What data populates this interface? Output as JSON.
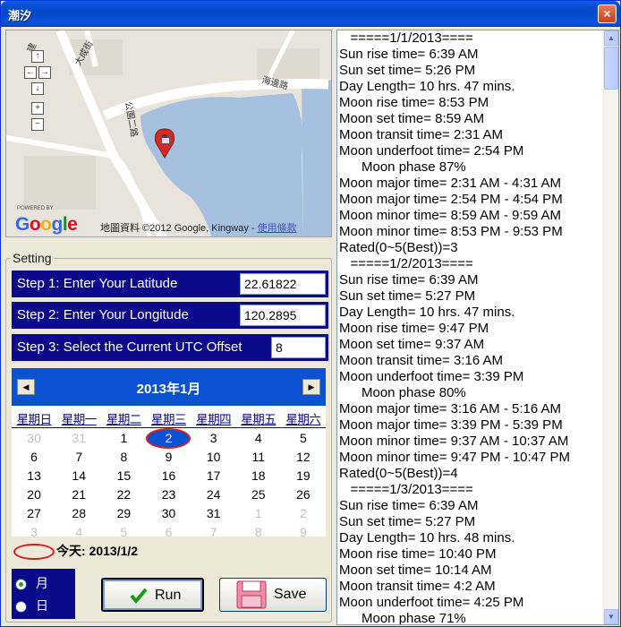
{
  "window": {
    "title": "潮汐",
    "close_label": "×"
  },
  "map": {
    "attribution": "地圖資料 ©2012 Google, Kingway -",
    "terms_link": "使用條款",
    "powered_by": "POWERED BY",
    "logo": "Google",
    "street_labels": [
      "大成街",
      "公園二路",
      "海邊路",
      "建"
    ],
    "nav": {
      "up": "↑",
      "left": "←",
      "right": "→",
      "down": "↓",
      "zoom_in": "+",
      "zoom_out": "−"
    }
  },
  "settings": {
    "legend": "Setting",
    "steps": [
      {
        "label": "Step 1:  Enter Your Latitude",
        "value": "22.61822"
      },
      {
        "label": "Step 2:  Enter Your Longitude",
        "value": "120.2895"
      },
      {
        "label": "Step 3:  Select the Current UTC Offset",
        "value": "8"
      }
    ]
  },
  "calendar": {
    "title": "2013年1月",
    "prev": "◀",
    "next": "▶",
    "weekdays": [
      "星期日",
      "星期一",
      "星期二",
      "星期三",
      "星期四",
      "星期五",
      "星期六"
    ],
    "weeks": [
      [
        {
          "d": "30",
          "o": true
        },
        {
          "d": "31",
          "o": true
        },
        {
          "d": "1"
        },
        {
          "d": "2",
          "sel": true
        },
        {
          "d": "3"
        },
        {
          "d": "4"
        },
        {
          "d": "5"
        }
      ],
      [
        {
          "d": "6"
        },
        {
          "d": "7"
        },
        {
          "d": "8"
        },
        {
          "d": "9"
        },
        {
          "d": "10"
        },
        {
          "d": "11"
        },
        {
          "d": "12"
        }
      ],
      [
        {
          "d": "13"
        },
        {
          "d": "14"
        },
        {
          "d": "15"
        },
        {
          "d": "16"
        },
        {
          "d": "17"
        },
        {
          "d": "18"
        },
        {
          "d": "19"
        }
      ],
      [
        {
          "d": "20"
        },
        {
          "d": "21"
        },
        {
          "d": "22"
        },
        {
          "d": "23"
        },
        {
          "d": "24"
        },
        {
          "d": "25"
        },
        {
          "d": "26"
        }
      ],
      [
        {
          "d": "27"
        },
        {
          "d": "28"
        },
        {
          "d": "29"
        },
        {
          "d": "30"
        },
        {
          "d": "31"
        },
        {
          "d": "1",
          "o": true
        },
        {
          "d": "2",
          "o": true
        }
      ],
      [
        {
          "d": "3",
          "o": true
        },
        {
          "d": "4",
          "o": true
        },
        {
          "d": "5",
          "o": true
        },
        {
          "d": "6",
          "o": true
        },
        {
          "d": "7",
          "o": true
        },
        {
          "d": "8",
          "o": true
        },
        {
          "d": "9",
          "o": true
        }
      ]
    ],
    "today_label": "今天: 2013/1/2"
  },
  "mode": {
    "month_label": "月",
    "day_label": "日",
    "selected": "month"
  },
  "buttons": {
    "run": "Run",
    "save": "Save"
  },
  "log": [
    "   =====1/1/2013====",
    "Sun rise time= 6:39 AM",
    "Sun set time= 5:26 PM",
    "Day Length= 10 hrs. 47 mins.",
    "Moon rise time= 8:53 PM",
    "Moon set time= 8:59 AM",
    "Moon transit time= 2:31 AM",
    "Moon underfoot time= 2:54 PM",
    "      Moon phase 87%",
    "Moon major time= 2:31 AM - 4:31 AM",
    "Moon major time= 2:54 PM - 4:54 PM",
    "Moon minor time= 8:59 AM - 9:59 AM",
    "Moon minor time= 8:53 PM - 9:53 PM",
    "Rated(0~5(Best))=3",
    "   =====1/2/2013====",
    "Sun rise time= 6:39 AM",
    "Sun set time= 5:27 PM",
    "Day Length= 10 hrs. 47 mins.",
    "Moon rise time= 9:47 PM",
    "Moon set time= 9:37 AM",
    "Moon transit time= 3:16 AM",
    "Moon underfoot time= 3:39 PM",
    "      Moon phase 80%",
    "Moon major time= 3:16 AM - 5:16 AM",
    "Moon major time= 3:39 PM - 5:39 PM",
    "Moon minor time= 9:37 AM - 10:37 AM",
    "Moon minor time= 9:47 PM - 10:47 PM",
    "Rated(0~5(Best))=4",
    "   =====1/3/2013====",
    "Sun rise time= 6:39 AM",
    "Sun set time= 5:27 PM",
    "Day Length= 10 hrs. 48 mins.",
    "Moon rise time= 10:40 PM",
    "Moon set time= 10:14 AM",
    "Moon transit time= 4:2 AM",
    "Moon underfoot time= 4:25 PM",
    "      Moon phase 71%"
  ],
  "colors": {
    "title_bar": "#0548c9",
    "step_bg": "#0a0a8a",
    "calendar_header": "#0a51d3",
    "selected_ring": "#d42020",
    "water": "#a6c0e0"
  }
}
